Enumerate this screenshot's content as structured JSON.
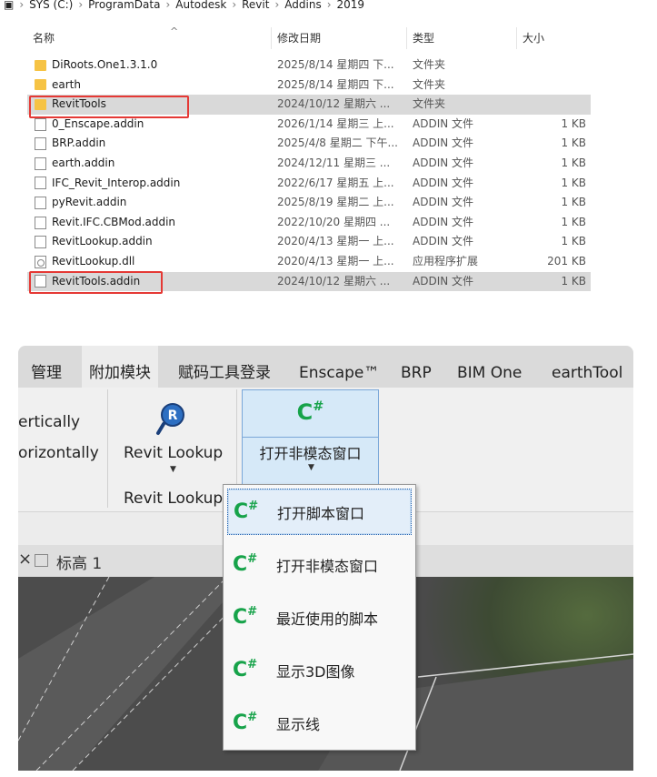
{
  "explorer": {
    "breadcrumb": [
      "SYS (C:)",
      "ProgramData",
      "Autodesk",
      "Revit",
      "Addins",
      "2019"
    ],
    "columns": {
      "name": "名称",
      "date": "修改日期",
      "type": "类型",
      "size": "大小"
    },
    "files": [
      {
        "name": "DiRoots.One1.3.1.0",
        "date": "2025/8/14 星期四 下...",
        "type": "文件夹",
        "size": "",
        "icon": "folder-icon"
      },
      {
        "name": "earth",
        "date": "2025/8/14 星期四 下...",
        "type": "文件夹",
        "size": "",
        "icon": "folder-icon"
      },
      {
        "name": "RevitTools",
        "date": "2024/10/12 星期六 ...",
        "type": "文件夹",
        "size": "",
        "icon": "folder-icon"
      },
      {
        "name": "0_Enscape.addin",
        "date": "2026/1/14 星期三 上...",
        "type": "ADDIN 文件",
        "size": "1 KB",
        "icon": "file-icon"
      },
      {
        "name": "BRP.addin",
        "date": "2025/4/8 星期二 下午...",
        "type": "ADDIN 文件",
        "size": "1 KB",
        "icon": "file-icon"
      },
      {
        "name": "earth.addin",
        "date": "2024/12/11 星期三 ...",
        "type": "ADDIN 文件",
        "size": "1 KB",
        "icon": "file-icon"
      },
      {
        "name": "IFC_Revit_Interop.addin",
        "date": "2022/6/17 星期五 上...",
        "type": "ADDIN 文件",
        "size": "1 KB",
        "icon": "file-icon"
      },
      {
        "name": "pyRevit.addin",
        "date": "2025/8/19 星期二 上...",
        "type": "ADDIN 文件",
        "size": "1 KB",
        "icon": "file-icon"
      },
      {
        "name": "Revit.IFC.CBMod.addin",
        "date": "2022/10/20 星期四 ...",
        "type": "ADDIN 文件",
        "size": "1 KB",
        "icon": "file-icon"
      },
      {
        "name": "RevitLookup.addin",
        "date": "2020/4/13 星期一 上...",
        "type": "ADDIN 文件",
        "size": "1 KB",
        "icon": "file-icon"
      },
      {
        "name": "RevitLookup.dll",
        "date": "2020/4/13 星期一 上...",
        "type": "应用程序扩展",
        "size": "201 KB",
        "icon": "dll-icon"
      },
      {
        "name": "RevitTools.addin",
        "date": "2024/10/12 星期六 ...",
        "type": "ADDIN 文件",
        "size": "1 KB",
        "icon": "file-icon"
      }
    ]
  },
  "revit": {
    "tabs": [
      "管理",
      "附加模块",
      "赋码工具登录",
      "Enscape™",
      "BRP",
      "BIM One",
      "earthTool"
    ],
    "ribbon": {
      "vertically": "ertically",
      "horizontally": "orizontally",
      "lookup_label": "Revit Lookup",
      "lookup_panel": "Revit Lookup",
      "cs_logo": "C",
      "cs_sharp": "#",
      "modeless_label": "打开非模态窗口"
    },
    "view_tab": {
      "close": "×",
      "level": "标高 1"
    },
    "menu": [
      "打开脚本窗口",
      "打开非模态窗口",
      "最近使用的脚本",
      "显示3D图像",
      "显示线"
    ]
  },
  "colors": {
    "highlight": "#e53935",
    "csharp": "#17a34a",
    "selected_row": "#d9d9d9",
    "menu_focus": "#e3eef9"
  }
}
